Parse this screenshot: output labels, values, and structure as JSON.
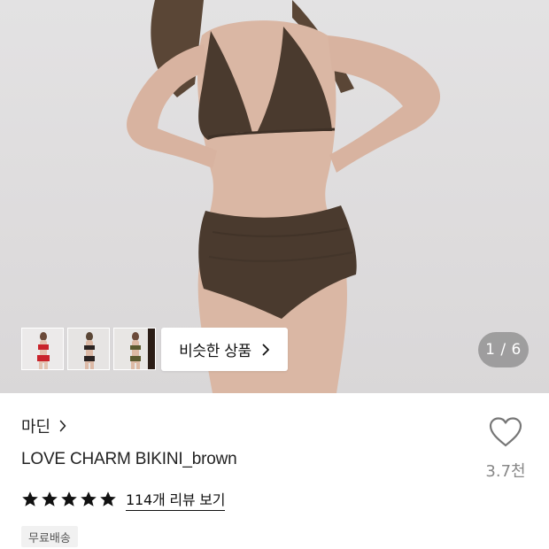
{
  "gallery": {
    "counter": "1 / 6",
    "similar_button_label": "비슷한 상품",
    "thumbnails": [
      {
        "name": "red-bikini-thumbnail",
        "swimsuit_color": "#c9232b"
      },
      {
        "name": "black-bikini-thumbnail",
        "swimsuit_color": "#2a2322"
      },
      {
        "name": "olive-bikini-thumbnail",
        "swimsuit_color": "#5b5a30"
      }
    ],
    "swimsuit_color": "#4a3a2e"
  },
  "product": {
    "brand": "마딘",
    "name": "LOVE CHARM BIKINI_brown",
    "likes": "3.7천",
    "rating_stars": 5,
    "review_link": "114개 리뷰 보기",
    "shipping_badge": "무료배송"
  }
}
